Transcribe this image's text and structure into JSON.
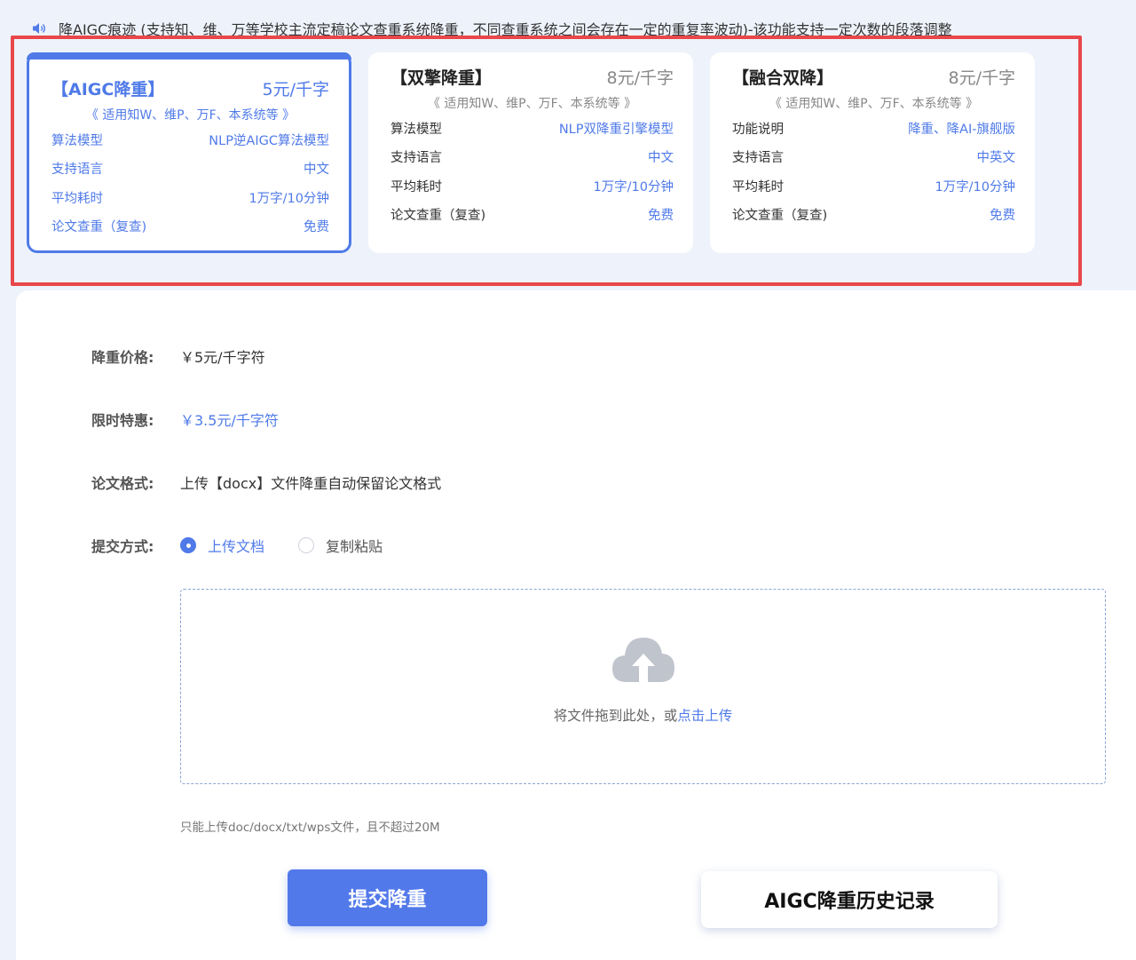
{
  "notice": {
    "icon": "speaker-icon",
    "text": "降AIGC痕迹 (支持知、维、万等学校主流定稿论文查重系统降重，不同查重系统之间会存在一定的重复率波动)-该功能支持一定次数的段落调整"
  },
  "plans": [
    {
      "name": "【AIGC降重】",
      "price": "5元/千字",
      "scope": "《 适用知W、维P、万F、本系统等 》",
      "selected": true,
      "rows": [
        {
          "k": "算法模型",
          "v": "NLP逆AIGC算法模型"
        },
        {
          "k": "支持语言",
          "v": "中文"
        },
        {
          "k": "平均耗时",
          "v": "1万字/10分钟"
        },
        {
          "k": "论文查重（复查)",
          "v": "免费"
        }
      ]
    },
    {
      "name": "【双擎降重】",
      "price": "8元/千字",
      "scope": "《 适用知W、维P、万F、本系统等 》",
      "selected": false,
      "rows": [
        {
          "k": "算法模型",
          "v": "NLP双降重引擎模型"
        },
        {
          "k": "支持语言",
          "v": "中文"
        },
        {
          "k": "平均耗时",
          "v": "1万字/10分钟"
        },
        {
          "k": "论文查重（复查)",
          "v": "免费"
        }
      ]
    },
    {
      "name": "【融合双降】",
      "price": "8元/千字",
      "scope": "《 适用知W、维P、万F、本系统等 》",
      "selected": false,
      "rows": [
        {
          "k": "功能说明",
          "v": "降重、降AI-旗舰版"
        },
        {
          "k": "支持语言",
          "v": "中英文"
        },
        {
          "k": "平均耗时",
          "v": "1万字/10分钟"
        },
        {
          "k": "论文查重（复查)",
          "v": "免费"
        }
      ]
    }
  ],
  "form": {
    "price_label": "降重价格:",
    "price_value": "￥5元/千字符",
    "promo_label": "限时特惠:",
    "promo_value": "￥3.5元/千字符",
    "format_label": "论文格式:",
    "format_value": "上传【docx】文件降重自动保留论文格式",
    "submit_mode_label": "提交方式:",
    "submit_modes": [
      {
        "label": "上传文档",
        "checked": true
      },
      {
        "label": "复制粘贴",
        "checked": false
      }
    ]
  },
  "upload": {
    "icon": "cloud-upload-icon",
    "hint": "将文件拖到此处，或",
    "link": "点击上传",
    "limit_note": "只能上传doc/docx/txt/wps文件，且不超过20M"
  },
  "actions": {
    "submit_label": "提交降重",
    "history_label": "AIGC降重历史记录"
  },
  "colors": {
    "accent": "#4f7ae8",
    "highlight": "#e8474b",
    "background": "#eef3fb"
  }
}
